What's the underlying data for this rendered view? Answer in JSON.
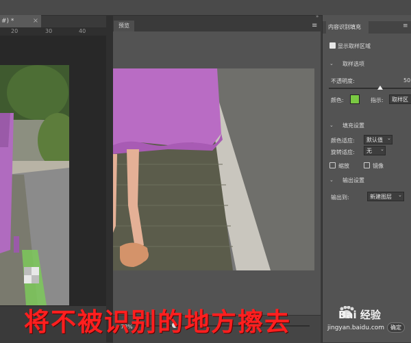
{
  "document": {
    "tab_title": "#) *",
    "ruler_ticks": [
      "20",
      "30",
      "40"
    ]
  },
  "preview": {
    "tab_label": "预览",
    "menu_icon": "hamburger-icon",
    "zoom_level": "73%"
  },
  "panel": {
    "tab_label": "内容识别填充",
    "show_sampling_label": "显示取样区域",
    "sampling_section": "取样选项",
    "opacity_label": "不透明度:",
    "opacity_value": "50",
    "color_label": "颜色:",
    "color_value": "#7ac943",
    "indicator_label": "指示:",
    "indicator_value": "取样区",
    "fill_section": "填充设置",
    "color_adapt_label": "颜色适应:",
    "color_adapt_value": "默认值",
    "rotation_adapt_label": "旋转适应:",
    "rotation_adapt_value": "无",
    "scale_label": "缩放",
    "mirror_label": "镜像",
    "output_section": "输出设置",
    "output_to_label": "输出到:",
    "output_to_value": "新建图层",
    "confirm_label": "确定"
  },
  "overlay": {
    "caption": "将不被识别的地方擦去",
    "watermark_brand": "Bai 经验",
    "watermark_url": "jingyan.baidu.com"
  }
}
